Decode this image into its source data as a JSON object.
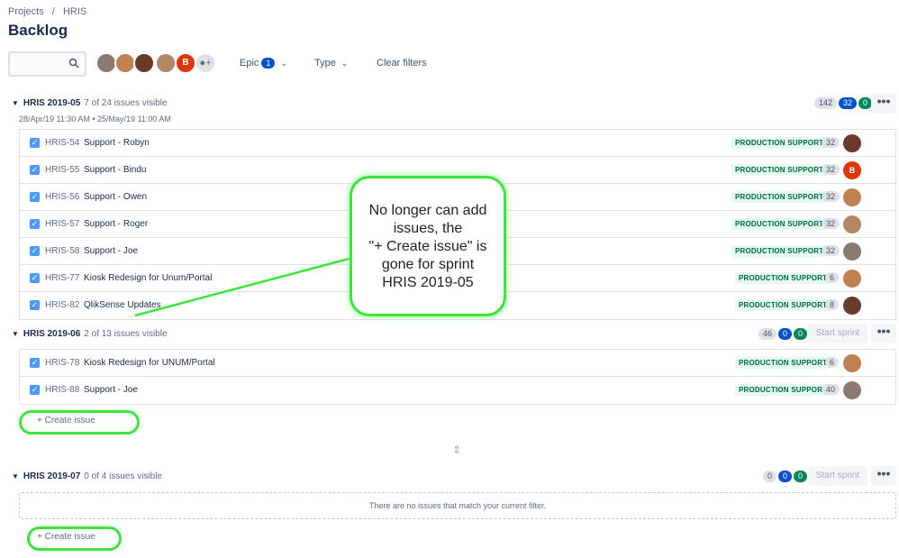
{
  "breadcrumb": {
    "projects": "Projects",
    "separator": "/",
    "project": "HRIS"
  },
  "page_title": "Backlog",
  "search": {
    "placeholder": ""
  },
  "filters": {
    "epic_label": "Epic",
    "epic_count": "1",
    "type_label": "Type",
    "clear_label": "Clear filters",
    "avatar_letter": "B"
  },
  "colors": {
    "avatar_robyn": "#6b3a2a",
    "avatar_bindu": "#de350b",
    "avatar_owen": "#c08050",
    "avatar_roger": "#b08868",
    "avatar_joe": "#8a7a70",
    "highlight_green": "#39e639"
  },
  "sprints": [
    {
      "name": "HRIS 2019-05",
      "visible": "7 of 24 issues visible",
      "dates": "28/Apr/19 11:30 AM • 25/May/19 11:00 AM",
      "counts": [
        "142",
        "32",
        "0"
      ],
      "issues": [
        {
          "key": "HRIS-54",
          "summary": "Support - Robyn",
          "epic": "PRODUCTION SUPPORT",
          "estimate": "32"
        },
        {
          "key": "HRIS-55",
          "summary": "Support - Bindu",
          "epic": "PRODUCTION SUPPORT",
          "estimate": "32"
        },
        {
          "key": "HRIS-56",
          "summary": "Support - Owen",
          "epic": "PRODUCTION SUPPORT",
          "estimate": "32"
        },
        {
          "key": "HRIS-57",
          "summary": "Support - Roger",
          "epic": "PRODUCTION SUPPORT",
          "estimate": "32"
        },
        {
          "key": "HRIS-58",
          "summary": "Support - Joe",
          "epic": "PRODUCTION SUPPORT",
          "estimate": "32"
        },
        {
          "key": "HRIS-77",
          "summary": "Kiosk Redesign for Unum/Portal",
          "epic": "PRODUCTION SUPPORT",
          "estimate": "6"
        },
        {
          "key": "HRIS-82",
          "summary": "QlikSense Updates",
          "epic": "PRODUCTION SUPPORT",
          "estimate": "8"
        }
      ]
    },
    {
      "name": "HRIS 2019-06",
      "visible": "2 of 13 issues visible",
      "counts": [
        "46",
        "0",
        "0"
      ],
      "start_label": "Start sprint",
      "issues": [
        {
          "key": "HRIS-78",
          "summary": "Kiosk Redesign for UNUM/Portal",
          "epic": "PRODUCTION SUPPORT",
          "estimate": "6"
        },
        {
          "key": "HRIS-88",
          "summary": "Support - Joe",
          "epic": "PRODUCTION SUPPORT",
          "estimate": "40"
        }
      ],
      "create_label": "+  Create issue"
    },
    {
      "name": "HRIS 2019-07",
      "visible": "0 of 4 issues visible",
      "counts": [
        "0",
        "0",
        "0"
      ],
      "start_label": "Start sprint",
      "empty_message": "There are no issues that match your current filter.",
      "create_label": "+  Create issue"
    }
  ],
  "more_label": "•••",
  "callout": {
    "line1": "No longer can add",
    "line2": "issues, the",
    "line3": "\"+ Create issue\" is",
    "line4": "gone for sprint",
    "line5": "HRIS 2019-05"
  }
}
